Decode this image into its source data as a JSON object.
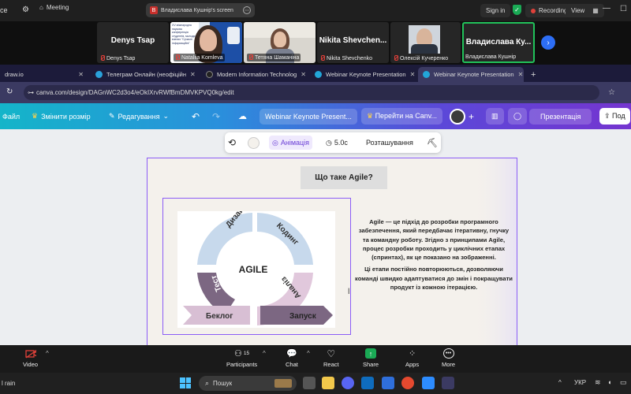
{
  "zoom_top": {
    "app_fragment": "ce",
    "meeting_label": "Meeting",
    "share_badge": "B",
    "share_text": "Владислава Кушнір's screen",
    "signin": "Sign in",
    "recording": "Recording",
    "view": "View"
  },
  "participants": [
    {
      "name_big": "Denys Tsap",
      "label": "Denys Tsap"
    },
    {
      "name_big": "",
      "label": "Nataliia Komleva"
    },
    {
      "name_big": "",
      "label": "Тетяна Шаманіна"
    },
    {
      "name_big": "Nikita  Shevchen...",
      "label": "Nikita Shevchenko"
    },
    {
      "name_big": "",
      "label": "Олексій Кучеренко"
    },
    {
      "name_big": "Владислава  Ку...",
      "label": "Владислава Кушнір"
    }
  ],
  "shared_slide_snippet": "XV міжнародна наукова конференція студентів, молодих вчених \"Сучасні інформаційні\"",
  "tabs": [
    {
      "label": "draw.io"
    },
    {
      "label": "Телеграм Онлайн (неофіційн"
    },
    {
      "label": "Modern Information Technolog"
    },
    {
      "label": "Webinar Keynote Presentation"
    },
    {
      "label": "Webinar Keynote Presentation"
    }
  ],
  "address": {
    "url": "canva.com/design/DAGnWC2d3o4/eOkIXrvRWfBmDMVKPVQ0kg/edit"
  },
  "canva_toolbar": {
    "file": "Файл",
    "resize": "Змінити розмір",
    "editing": "Редагування",
    "doc_title": "Webinar Keynote Present...",
    "upgrade": "Перейти на Canv...",
    "present": "Презентація",
    "share": "Под"
  },
  "context_toolbar": {
    "animation": "Анімація",
    "duration": "5.0с",
    "position": "Розташування"
  },
  "slide": {
    "title": "Що таке Agile?",
    "para1": "Agile — це підхід до розробки програмного забезпечення, який передбачає ітеративну, гнучку та командну роботу. Згідно з принципами Agile, процес розробки проходить у циклічних етапах (спринтах), як це показано на зображенні.",
    "para2": "Ці етапи постійно повторюються, дозволяючи команді швидко адаптуватися до змін і покращувати продукт із кожною ітерацією.",
    "diagram": {
      "center": "AGILE",
      "design": "Дизайн",
      "coding": "Кодинг",
      "test": "Тест",
      "analysis": "Аналіз",
      "backlog": "Беклог",
      "launch": "Запуск"
    }
  },
  "meeting_controls": {
    "video": "Video",
    "participants_count": "15",
    "participants": "Participants",
    "chat": "Chat",
    "react": "React",
    "share": "Share",
    "apps": "Apps",
    "more": "More"
  },
  "taskbar": {
    "weather": "l rain",
    "search": "Пошук",
    "lang": "УКР"
  },
  "colors": {
    "record_red": "#e0413a",
    "canva_accent": "#8b5cf6",
    "share_green": "#1aaa55"
  }
}
